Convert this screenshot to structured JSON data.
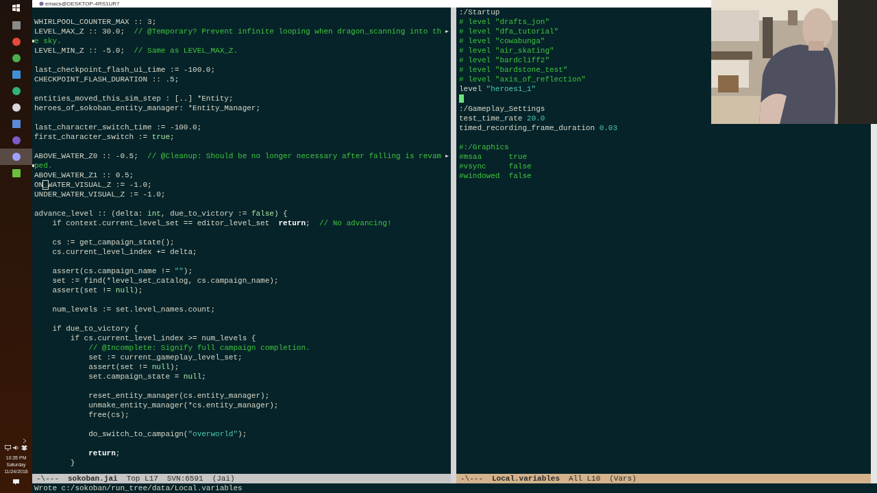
{
  "window": {
    "title": "emacs@DESKTOP-4RS1UR7"
  },
  "taskbar": {
    "apps": [
      {
        "selected": false
      },
      {
        "selected": false
      },
      {
        "selected": false
      },
      {
        "selected": false
      },
      {
        "selected": false
      },
      {
        "selected": false
      },
      {
        "selected": false
      },
      {
        "selected": false
      },
      {
        "selected": true
      },
      {
        "selected": false
      }
    ],
    "clock": {
      "time": "10:35 PM",
      "day": "Saturday",
      "date": "11/24/2018"
    }
  },
  "panes": [
    {
      "active": false,
      "lines": [
        {
          "segments": [
            {
              "kind": "plain",
              "text": "WHIRLPOOL_COUNTER_MAX :: 3;"
            }
          ]
        },
        {
          "wrapped": true,
          "segments": [
            {
              "kind": "plain",
              "text": "LEVEL_MAX_Z :: 30.0;  "
            },
            {
              "kind": "comment",
              "text": "// @Temporary? Prevent infinite looping when dragon_scanning into th"
            }
          ]
        },
        {
          "segments": [
            {
              "kind": "comment",
              "text": "e sky."
            }
          ]
        },
        {
          "segments": [
            {
              "kind": "plain",
              "text": "LEVEL_MIN_Z :: -5.0;  "
            },
            {
              "kind": "comment",
              "text": "// Same as LEVEL_MAX_Z."
            }
          ]
        },
        {
          "after_blank": true,
          "segments": [
            {
              "kind": "plain",
              "text": "last_checkpoint_flash_ui_time := -100.0;"
            }
          ]
        },
        {
          "segments": [
            {
              "kind": "plain",
              "text": "CHECKPOINT_FLASH_DURATION :: .5;"
            }
          ]
        },
        {
          "after_blank": true,
          "segments": [
            {
              "kind": "plain",
              "text": "entities_moved_this_sim_step : [..] *Entity;"
            }
          ]
        },
        {
          "segments": [
            {
              "kind": "plain",
              "text": "heroes_of_sokoban_entity_manager: *Entity_Manager;"
            }
          ]
        },
        {
          "after_blank": true,
          "segments": [
            {
              "kind": "plain",
              "text": "last_character_switch_time := -100.0;"
            }
          ]
        },
        {
          "segments": [
            {
              "kind": "plain",
              "text": "first_character_switch := "
            },
            {
              "kind": "literal",
              "text": "true"
            },
            {
              "kind": "plain",
              "text": ";"
            }
          ]
        },
        {
          "after_blank": true,
          "wrapped": true,
          "segments": [
            {
              "kind": "plain",
              "text": "ABOVE_WATER_Z0 :: -0.5;  "
            },
            {
              "kind": "comment",
              "text": "// @Cleanup: Should be no longer necessary after falling is revam"
            }
          ]
        },
        {
          "segments": [
            {
              "kind": "comment",
              "text": "ped."
            }
          ]
        },
        {
          "segments": [
            {
              "kind": "plain",
              "text": "ABOVE_WATER_Z1 :: 0.5;"
            }
          ]
        },
        {
          "segments": [
            {
              "kind": "plain",
              "text": "ON"
            },
            {
              "kind": "cursor",
              "text": "_"
            },
            {
              "kind": "plain",
              "text": "WATER_VISUAL_Z := -1.0;"
            }
          ]
        },
        {
          "segments": [
            {
              "kind": "plain",
              "text": "UNDER_WATER_VISUAL_Z := -1.0;"
            }
          ]
        },
        {
          "after_blank": true,
          "segments": [
            {
              "kind": "plain",
              "text": "advance_level :: (delta: "
            },
            {
              "kind": "literal",
              "text": "int"
            },
            {
              "kind": "plain",
              "text": ", due_to_victory := "
            },
            {
              "kind": "literal",
              "text": "false"
            },
            {
              "kind": "plain",
              "text": ") {"
            }
          ]
        },
        {
          "segments": [
            {
              "kind": "plain",
              "text": "    if context.current_level_set == editor_level_set  "
            },
            {
              "kind": "keyword",
              "text": "return"
            },
            {
              "kind": "plain",
              "text": ";  "
            },
            {
              "kind": "comment",
              "text": "// No advancing!"
            }
          ]
        },
        {
          "after_blank": true,
          "segments": [
            {
              "kind": "plain",
              "text": "    cs := get_campaign_state();"
            }
          ]
        },
        {
          "segments": [
            {
              "kind": "plain",
              "text": "    cs.current_level_index += delta;"
            }
          ]
        },
        {
          "after_blank": true,
          "segments": [
            {
              "kind": "plain",
              "text": "    assert(cs.campaign_name != "
            },
            {
              "kind": "string",
              "text": "\"\""
            },
            {
              "kind": "plain",
              "text": ");"
            }
          ]
        },
        {
          "segments": [
            {
              "kind": "plain",
              "text": "    set := find(*level_set_catalog, cs.campaign_name);"
            }
          ]
        },
        {
          "segments": [
            {
              "kind": "plain",
              "text": "    assert(set != "
            },
            {
              "kind": "literal",
              "text": "null"
            },
            {
              "kind": "plain",
              "text": ");"
            }
          ]
        },
        {
          "after_blank": true,
          "segments": [
            {
              "kind": "plain",
              "text": "    num_levels := set.level_names.count;"
            }
          ]
        },
        {
          "after_blank": true,
          "segments": [
            {
              "kind": "plain",
              "text": "    if due_to_victory {"
            }
          ]
        },
        {
          "segments": [
            {
              "kind": "plain",
              "text": "        if cs.current_level_index >= num_levels {"
            }
          ]
        },
        {
          "segments": [
            {
              "kind": "comment",
              "text": "            // @Incomplete: Signify full campaign completion."
            }
          ]
        },
        {
          "segments": [
            {
              "kind": "plain",
              "text": "            set := current_gameplay_level_set;"
            }
          ]
        },
        {
          "segments": [
            {
              "kind": "plain",
              "text": "            assert(set != "
            },
            {
              "kind": "literal",
              "text": "null"
            },
            {
              "kind": "plain",
              "text": ");"
            }
          ]
        },
        {
          "segments": [
            {
              "kind": "plain",
              "text": "            set.campaign_state = "
            },
            {
              "kind": "literal",
              "text": "null"
            },
            {
              "kind": "plain",
              "text": ";"
            }
          ]
        },
        {
          "after_blank": true,
          "segments": [
            {
              "kind": "plain",
              "text": "            reset_entity_manager(cs.entity_manager);"
            }
          ]
        },
        {
          "segments": [
            {
              "kind": "plain",
              "text": "            unmake_entity_manager(*cs.entity_manager);"
            }
          ]
        },
        {
          "segments": [
            {
              "kind": "plain",
              "text": "            free(cs);"
            }
          ]
        },
        {
          "after_blank": true,
          "segments": [
            {
              "kind": "plain",
              "text": "            do_switch_to_campaign("
            },
            {
              "kind": "string",
              "text": "\"overworld\""
            },
            {
              "kind": "plain",
              "text": ");"
            }
          ]
        },
        {
          "after_blank": true,
          "segments": [
            {
              "kind": "keyword",
              "text": "            return"
            },
            {
              "kind": "plain",
              "text": ";"
            }
          ]
        },
        {
          "segments": [
            {
              "kind": "plain",
              "text": "        }"
            }
          ]
        }
      ],
      "mode_line": {
        "flags": "-\\---",
        "buffer": "sokoban.jai",
        "position": "Top L17",
        "vc": "SVN:6591",
        "mode": "(Jai)"
      }
    },
    {
      "active": true,
      "lines": [
        {
          "segments": [
            {
              "kind": "plain",
              "text": ":/Startup"
            }
          ]
        },
        {
          "segments": [
            {
              "kind": "comment",
              "text": "# level \"drafts_jon\""
            }
          ]
        },
        {
          "segments": [
            {
              "kind": "comment",
              "text": "# level \"dfa_tutorial\""
            }
          ]
        },
        {
          "segments": [
            {
              "kind": "comment",
              "text": "# level \"cowabunga\""
            }
          ]
        },
        {
          "segments": [
            {
              "kind": "comment",
              "text": "# level \"air_skating\""
            }
          ]
        },
        {
          "segments": [
            {
              "kind": "comment",
              "text": "# level \"bardcliff2\""
            }
          ]
        },
        {
          "segments": [
            {
              "kind": "comment",
              "text": "# level \"bardstone_test\""
            }
          ]
        },
        {
          "segments": [
            {
              "kind": "comment",
              "text": "# level \"axis_of_reflection\""
            }
          ]
        },
        {
          "segments": [
            {
              "kind": "plain",
              "text": "level "
            },
            {
              "kind": "string",
              "text": "\"heroes1_1\""
            }
          ]
        },
        {
          "cursor": true
        },
        {
          "segments": [
            {
              "kind": "plain",
              "text": ":/Gameplay_Settings"
            }
          ]
        },
        {
          "segments": [
            {
              "kind": "plain",
              "text": "test_time_rate "
            },
            {
              "kind": "string",
              "text": "20.0"
            }
          ]
        },
        {
          "segments": [
            {
              "kind": "plain",
              "text": "timed_recording_frame_duration "
            },
            {
              "kind": "string",
              "text": "0.03"
            }
          ]
        },
        {
          "after_blank": true,
          "segments": [
            {
              "kind": "comment",
              "text": "#:/Graphics"
            }
          ]
        },
        {
          "segments": [
            {
              "kind": "comment",
              "text": "#msaa      true"
            }
          ]
        },
        {
          "segments": [
            {
              "kind": "comment",
              "text": "#vsync     false"
            }
          ]
        },
        {
          "segments": [
            {
              "kind": "comment",
              "text": "#windowed  false"
            }
          ]
        }
      ],
      "mode_line": {
        "flags": "-\\---",
        "buffer": "Local.variables",
        "position": "All L10",
        "mode": "(Vars)"
      }
    }
  ],
  "echo_area": "Wrote c:/sokoban/run_tree/data/Local.variables"
}
